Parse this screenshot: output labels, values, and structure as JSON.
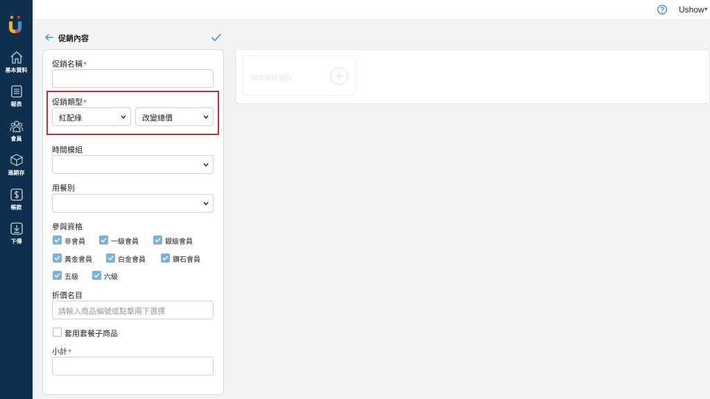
{
  "app": {
    "user_name": "Ushow",
    "user_caret": "▾"
  },
  "sidebar": {
    "items": [
      {
        "label": "基本資料",
        "icon": "home-icon"
      },
      {
        "label": "報表",
        "icon": "report-icon"
      },
      {
        "label": "會員",
        "icon": "members-icon"
      },
      {
        "label": "進銷存",
        "icon": "box-icon"
      },
      {
        "label": "帳款",
        "icon": "dollar-icon"
      },
      {
        "label": "下傳",
        "icon": "download-icon"
      }
    ]
  },
  "header": {
    "title": "促銷內容"
  },
  "form": {
    "promo_name": {
      "label": "促銷名稱",
      "required_mark": "*",
      "value": ""
    },
    "promo_type": {
      "label": "促銷類型",
      "required_mark": "*",
      "type_value": "紅配綠",
      "subtype_value": "改變總價"
    },
    "time_group": {
      "label": "時間模組",
      "value": ""
    },
    "meal_type": {
      "label": "用餐別",
      "value": ""
    },
    "eligibility": {
      "label": "參與資格",
      "options": [
        {
          "label": "非會員",
          "checked": true
        },
        {
          "label": "一級會員",
          "checked": true
        },
        {
          "label": "銀級會員",
          "checked": true
        },
        {
          "label": "黃金會員",
          "checked": true
        },
        {
          "label": "白金會員",
          "checked": true
        },
        {
          "label": "鑽石會員",
          "checked": true
        },
        {
          "label": "五級",
          "checked": true
        },
        {
          "label": "六級",
          "checked": true
        }
      ]
    },
    "discount_item": {
      "label": "折價名目",
      "placeholder": "請輸入商品編號或點擊兩下選擇"
    },
    "apply_combo": {
      "label": "套用套餐子商品",
      "checked": false
    },
    "subtotal": {
      "label": "小計",
      "required_mark": "*",
      "value": ""
    }
  },
  "rules_panel": {
    "add_rule_label": "新增促銷規則"
  },
  "colors": {
    "sidebar_bg": "#0e2f4d",
    "accent": "#3a8fd6",
    "checkbox_checked": "#7cb1dd",
    "required": "#e02c2c",
    "highlight_border": "#d42a2a"
  }
}
